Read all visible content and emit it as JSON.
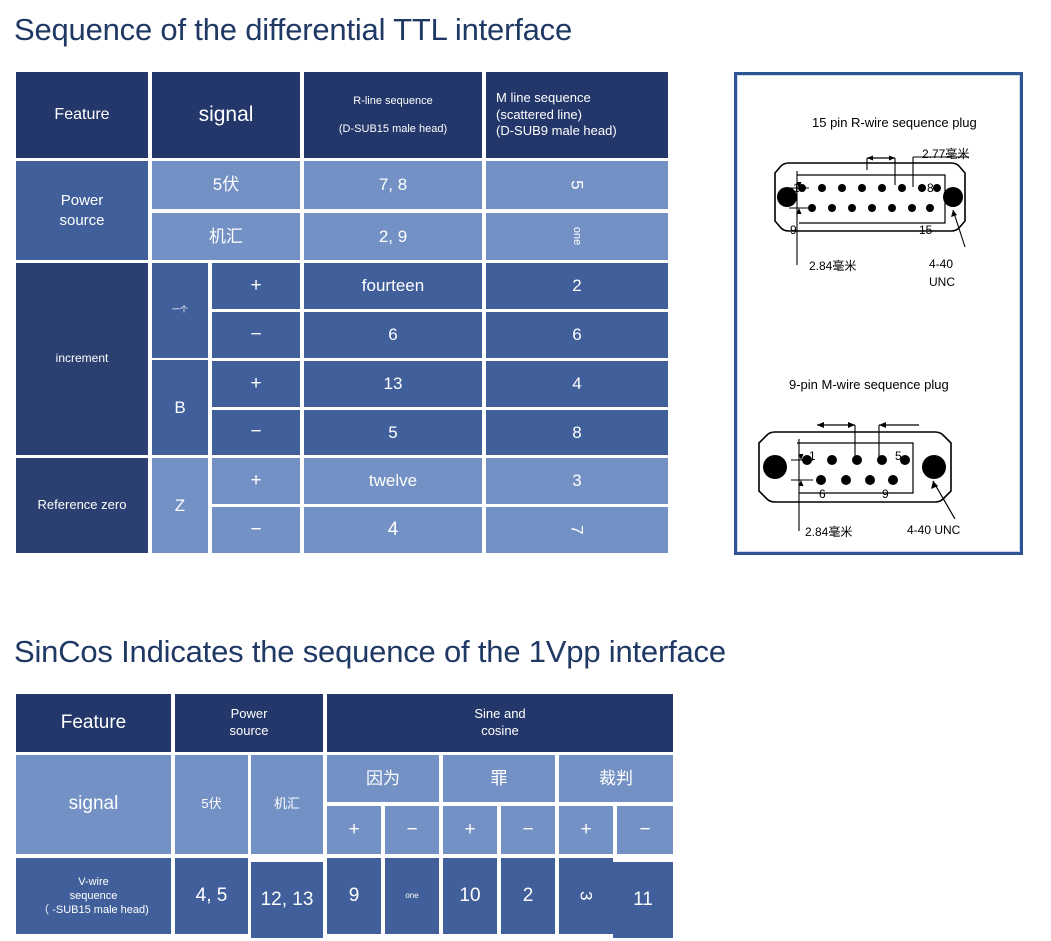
{
  "titles": {
    "section1": "Sequence of the differential TTL interface",
    "section2": "SinCos Indicates the sequence of the 1Vpp interface"
  },
  "colors": {
    "title": "#1f3864",
    "header_dark": "#23376a",
    "cell_dark": "#2b3f70",
    "cell_mid": "#41609b",
    "cell_light": "#7391c4",
    "panel_border": "#2e5496"
  },
  "table1": {
    "headers": {
      "feature": "Feature",
      "signal": "signal",
      "r_line_1": "R-line sequence",
      "r_line_2": "(D-SUB15 male head)",
      "m_line_1": "M line sequence",
      "m_line_2": "(scattered line)",
      "m_line_3": "(D-SUB9 male head)"
    },
    "groups": {
      "power": "Power\nsource",
      "power_1": "Power",
      "power_2": "source",
      "increment": "increment",
      "reference_zero": "Reference zero"
    },
    "rows": [
      {
        "signal": "5伏",
        "sub": "",
        "r": "7, 8",
        "m": "5",
        "m_rot": true
      },
      {
        "signal": "机汇",
        "sub": "",
        "r": "2, 9",
        "m": "one",
        "m_rot": true
      },
      {
        "signal": "一个",
        "sub": "+",
        "r": "fourteen",
        "m": "2",
        "m_rot": false
      },
      {
        "signal": "一个",
        "sub": "−",
        "r": "6",
        "m": "6",
        "m_rot": false
      },
      {
        "signal": "B",
        "sub": "+",
        "r": "13",
        "m": "4",
        "m_rot": false
      },
      {
        "signal": "B",
        "sub": "−",
        "r": "5",
        "m": "8",
        "m_rot": false
      },
      {
        "signal": "Z",
        "sub": "+",
        "r": "twelve",
        "m": "3",
        "m_rot": false
      },
      {
        "signal": "Z",
        "sub": "−",
        "r": "4",
        "m": "7",
        "m_rot": true
      }
    ],
    "axis_labels": {
      "a": "一个",
      "b": "B",
      "z": "Z"
    },
    "plus": "+",
    "minus": "−"
  },
  "table2": {
    "headers": {
      "feature": "Feature",
      "power_1": "Power",
      "power_2": "source",
      "sine_1": "Sine and",
      "sine_2": "cosine"
    },
    "signal_row": {
      "label": "signal",
      "power_5v": "5伏",
      "power_gnd": "机汇",
      "pairs": [
        {
          "name": "因为",
          "plus": "+",
          "minus": "−"
        },
        {
          "name": "罪",
          "plus": "+",
          "minus": "−"
        },
        {
          "name": "裁判",
          "plus": "+",
          "minus": "−"
        }
      ]
    },
    "pin_row": {
      "label_1": "V-wire",
      "label_2": "sequence",
      "label_3": "（ -SUB15 male head)",
      "values": [
        {
          "text": "4, 5",
          "rot": false,
          "small": false
        },
        {
          "text": "12, 13",
          "rot": false,
          "small": false
        },
        {
          "text": "9",
          "rot": false,
          "small": false
        },
        {
          "text": "one",
          "rot": false,
          "small": true
        },
        {
          "text": "10",
          "rot": false,
          "small": false
        },
        {
          "text": "2",
          "rot": false,
          "small": false
        },
        {
          "text": "3",
          "rot": true,
          "small": false
        },
        {
          "text": "11",
          "rot": false,
          "small": false
        }
      ]
    }
  },
  "diagram": {
    "top": {
      "caption": "15 pin R-wire sequence plug",
      "dim_top": "2.77毫米",
      "dim_left": "2.84毫米",
      "thread_1": "4-40",
      "thread_2": "UNC",
      "pin_tl": "1",
      "pin_tr": "8",
      "pin_bl": "9",
      "pin_br": "15"
    },
    "bottom": {
      "caption": "9-pin M-wire sequence plug",
      "dim_left": "2.84毫米",
      "thread": "4-40 UNC",
      "pin_tl": "1",
      "pin_tr": "5",
      "pin_bl": "6",
      "pin_br": "9"
    }
  }
}
